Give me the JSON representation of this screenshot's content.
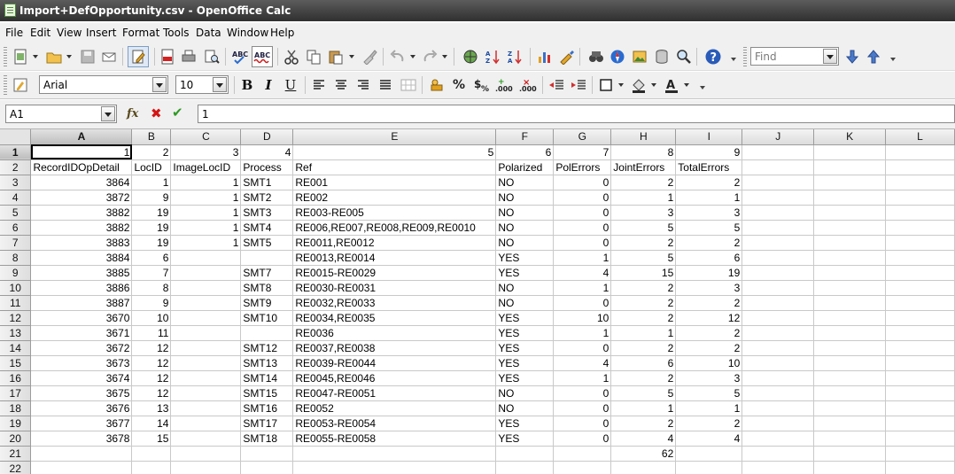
{
  "window": {
    "title": "Import+DefOpportunity.csv - OpenOffice Calc"
  },
  "menu": [
    "File",
    "Edit",
    "View",
    "Insert",
    "Format",
    "Tools",
    "Data",
    "Window",
    "Help"
  ],
  "toolbar": {
    "font_name": "Arial",
    "font_size": "10",
    "find_placeholder": "Find",
    "bold_label": "B",
    "italic_label": "I",
    "underline_label": "U",
    "percent_label": "%",
    "decimal_add_label": "0.0",
    "decimal_del_label": "0.0"
  },
  "formula_bar": {
    "name_box": "A1",
    "fx_label": "fx",
    "cancel_label": "✖",
    "accept_label": "✔",
    "content": "1"
  },
  "sheet": {
    "columns": [
      "A",
      "B",
      "C",
      "D",
      "E",
      "F",
      "G",
      "H",
      "I",
      "J",
      "K",
      "L"
    ],
    "rows": [
      [
        "1",
        "2",
        "3",
        "4",
        "5",
        "6",
        "7",
        "8",
        "9",
        "",
        "",
        ""
      ],
      [
        "RecordIDOpDetail",
        "LocID",
        "ImageLocID",
        "Process",
        "Ref",
        "Polarized",
        "PolErrors",
        "JointErrors",
        "TotalErrors",
        "",
        "",
        ""
      ],
      [
        "3864",
        "1",
        "1",
        "SMT1",
        "RE001",
        "NO",
        "0",
        "2",
        "2",
        "",
        "",
        ""
      ],
      [
        "3872",
        "9",
        "1",
        "SMT2",
        "RE002",
        "NO",
        "0",
        "1",
        "1",
        "",
        "",
        ""
      ],
      [
        "3882",
        "19",
        "1",
        "SMT3",
        "RE003-RE005",
        "NO",
        "0",
        "3",
        "3",
        "",
        "",
        ""
      ],
      [
        "3882",
        "19",
        "1",
        "SMT4",
        "RE006,RE007,RE008,RE009,RE0010",
        "NO",
        "0",
        "5",
        "5",
        "",
        "",
        ""
      ],
      [
        "3883",
        "19",
        "1",
        "SMT5",
        "RE0011,RE0012",
        "NO",
        "0",
        "2",
        "2",
        "",
        "",
        ""
      ],
      [
        "3884",
        "6",
        "",
        "",
        "RE0013,RE0014",
        "YES",
        "1",
        "5",
        "6",
        "",
        "",
        ""
      ],
      [
        "3885",
        "7",
        "",
        "SMT7",
        "RE0015-RE0029",
        "YES",
        "4",
        "15",
        "19",
        "",
        "",
        ""
      ],
      [
        "3886",
        "8",
        "",
        "SMT8",
        "RE0030-RE0031",
        "NO",
        "1",
        "2",
        "3",
        "",
        "",
        ""
      ],
      [
        "3887",
        "9",
        "",
        "SMT9",
        "RE0032,RE0033",
        "NO",
        "0",
        "2",
        "2",
        "",
        "",
        ""
      ],
      [
        "3670",
        "10",
        "",
        "SMT10",
        "RE0034,RE0035",
        "YES",
        "10",
        "2",
        "12",
        "",
        "",
        ""
      ],
      [
        "3671",
        "11",
        "",
        "",
        "RE0036",
        "YES",
        "1",
        "1",
        "2",
        "",
        "",
        ""
      ],
      [
        "3672",
        "12",
        "",
        "SMT12",
        "RE0037,RE0038",
        "YES",
        "0",
        "2",
        "2",
        "",
        "",
        ""
      ],
      [
        "3673",
        "12",
        "",
        "SMT13",
        "RE0039-RE0044",
        "YES",
        "4",
        "6",
        "10",
        "",
        "",
        ""
      ],
      [
        "3674",
        "12",
        "",
        "SMT14",
        "RE0045,RE0046",
        "YES",
        "1",
        "2",
        "3",
        "",
        "",
        ""
      ],
      [
        "3675",
        "12",
        "",
        "SMT15",
        "RE0047-RE0051",
        "NO",
        "0",
        "5",
        "5",
        "",
        "",
        ""
      ],
      [
        "3676",
        "13",
        "",
        "SMT16",
        "RE0052",
        "NO",
        "0",
        "1",
        "1",
        "",
        "",
        ""
      ],
      [
        "3677",
        "14",
        "",
        "SMT17",
        "RE0053-RE0054",
        "YES",
        "0",
        "2",
        "2",
        "",
        "",
        ""
      ],
      [
        "3678",
        "15",
        "",
        "SMT18",
        "RE0055-RE0058",
        "YES",
        "0",
        "4",
        "4",
        "",
        "",
        ""
      ],
      [
        "",
        "",
        "",
        "",
        "",
        "",
        "",
        "62",
        "",
        "",
        "",
        ""
      ],
      [
        "",
        "",
        "",
        "",
        "",
        "",
        "",
        "",
        "",
        "",
        "",
        ""
      ]
    ],
    "active_cell": "A1"
  }
}
